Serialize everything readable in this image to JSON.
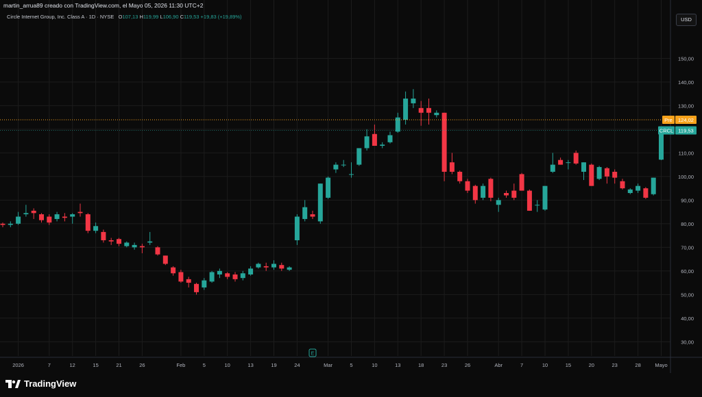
{
  "header": {
    "text": "martin_arrua89 creado con TradingView.com, el Mayo 05, 2026 11:30 UTC+2"
  },
  "legend": {
    "symbol": "Circle Internet Group, Inc. Class A · 1D · NYSE",
    "o_label": "O",
    "o_value": "107,13",
    "h_label": "H",
    "h_value": "119,99",
    "l_label": "L",
    "l_value": "106,90",
    "c_label": "C",
    "c_value": "119,53",
    "change": "+19,83 (+19,89%)"
  },
  "currency": "USD",
  "brand": {
    "name": "TradingView"
  },
  "colors": {
    "up": "#26a69a",
    "down": "#f23645",
    "pre": "#f7a21b",
    "background": "#0b0b0b",
    "grid": "#1c1c1c"
  },
  "chart_data": {
    "type": "candlestick",
    "title": "Circle Internet Group, Inc. Class A · 1D · NYSE",
    "ylim": [
      24,
      162
    ],
    "y_ticks": [
      30,
      40,
      50,
      60,
      70,
      80,
      90,
      100,
      110,
      120,
      130,
      140,
      150
    ],
    "y_tick_labels": [
      "30,00",
      "40,00",
      "50,00",
      "60,00",
      "70,00",
      "80,00",
      "90,00",
      "100,00",
      "110,00",
      "120,00",
      "130,00",
      "140,00",
      "150,00"
    ],
    "x_ticks": [
      {
        "i": 2,
        "label": "2026"
      },
      {
        "i": 6,
        "label": "7"
      },
      {
        "i": 9,
        "label": "12"
      },
      {
        "i": 12,
        "label": "15"
      },
      {
        "i": 15,
        "label": "21"
      },
      {
        "i": 18,
        "label": "26"
      },
      {
        "i": 23,
        "label": "Feb"
      },
      {
        "i": 26,
        "label": "5"
      },
      {
        "i": 29,
        "label": "10"
      },
      {
        "i": 32,
        "label": "13"
      },
      {
        "i": 35,
        "label": "19"
      },
      {
        "i": 38,
        "label": "24"
      },
      {
        "i": 42,
        "label": "Mar"
      },
      {
        "i": 45,
        "label": "5"
      },
      {
        "i": 48,
        "label": "10"
      },
      {
        "i": 51,
        "label": "13"
      },
      {
        "i": 54,
        "label": "18"
      },
      {
        "i": 57,
        "label": "23"
      },
      {
        "i": 60,
        "label": "26"
      },
      {
        "i": 64,
        "label": "Abr"
      },
      {
        "i": 67,
        "label": "7"
      },
      {
        "i": 70,
        "label": "10"
      },
      {
        "i": 73,
        "label": "15"
      },
      {
        "i": 76,
        "label": "20"
      },
      {
        "i": 79,
        "label": "23"
      },
      {
        "i": 82,
        "label": "28"
      },
      {
        "i": 85,
        "label": "Mayo"
      }
    ],
    "candles": [
      {
        "o": 80,
        "h": 80.5,
        "l": 78.5,
        "c": 79.5
      },
      {
        "o": 79.5,
        "h": 81,
        "l": 78.5,
        "c": 80
      },
      {
        "o": 80,
        "h": 85,
        "l": 79.5,
        "c": 83
      },
      {
        "o": 84,
        "h": 88,
        "l": 83,
        "c": 84.5
      },
      {
        "o": 85.5,
        "h": 86.5,
        "l": 82,
        "c": 84.5
      },
      {
        "o": 84,
        "h": 84.5,
        "l": 80.5,
        "c": 81.5
      },
      {
        "o": 83,
        "h": 84,
        "l": 79.5,
        "c": 80.5
      },
      {
        "o": 82,
        "h": 85,
        "l": 81,
        "c": 84
      },
      {
        "o": 83,
        "h": 84.5,
        "l": 81,
        "c": 82.5
      },
      {
        "o": 83,
        "h": 84.5,
        "l": 80,
        "c": 84
      },
      {
        "o": 85,
        "h": 88.5,
        "l": 83,
        "c": 84.5
      },
      {
        "o": 84,
        "h": 84.5,
        "l": 76,
        "c": 77
      },
      {
        "o": 77,
        "h": 80.5,
        "l": 76,
        "c": 79
      },
      {
        "o": 76.5,
        "h": 77.5,
        "l": 72,
        "c": 73
      },
      {
        "o": 73,
        "h": 74,
        "l": 71,
        "c": 72.5
      },
      {
        "o": 73.5,
        "h": 74,
        "l": 70.5,
        "c": 71.5
      },
      {
        "o": 70.5,
        "h": 72.5,
        "l": 70,
        "c": 72
      },
      {
        "o": 70,
        "h": 72,
        "l": 69,
        "c": 71
      },
      {
        "o": 70.5,
        "h": 71.5,
        "l": 67.5,
        "c": 70
      },
      {
        "o": 72,
        "h": 76.5,
        "l": 71,
        "c": 72.5
      },
      {
        "o": 70,
        "h": 70.5,
        "l": 66.5,
        "c": 67
      },
      {
        "o": 66.5,
        "h": 66.5,
        "l": 62.5,
        "c": 63
      },
      {
        "o": 61.5,
        "h": 62,
        "l": 58,
        "c": 59
      },
      {
        "o": 59.5,
        "h": 60.5,
        "l": 55,
        "c": 55.5
      },
      {
        "o": 56.5,
        "h": 57.5,
        "l": 53,
        "c": 55
      },
      {
        "o": 54.5,
        "h": 55,
        "l": 50,
        "c": 51
      },
      {
        "o": 53,
        "h": 57,
        "l": 52,
        "c": 56
      },
      {
        "o": 55.5,
        "h": 60,
        "l": 55,
        "c": 59.5
      },
      {
        "o": 58.5,
        "h": 61,
        "l": 57,
        "c": 60
      },
      {
        "o": 59,
        "h": 59.5,
        "l": 56.5,
        "c": 57.5
      },
      {
        "o": 58.5,
        "h": 59.5,
        "l": 55.5,
        "c": 56.5
      },
      {
        "o": 57,
        "h": 60,
        "l": 56,
        "c": 59
      },
      {
        "o": 58.5,
        "h": 62,
        "l": 58,
        "c": 61
      },
      {
        "o": 61.5,
        "h": 63.5,
        "l": 61,
        "c": 63
      },
      {
        "o": 62,
        "h": 63.5,
        "l": 60,
        "c": 61.5
      },
      {
        "o": 61.5,
        "h": 64.5,
        "l": 60.5,
        "c": 63
      },
      {
        "o": 62.5,
        "h": 63.5,
        "l": 60,
        "c": 61
      },
      {
        "o": 60.5,
        "h": 62,
        "l": 60,
        "c": 61.5
      },
      {
        "o": 73,
        "h": 84,
        "l": 71,
        "c": 83
      },
      {
        "o": 82,
        "h": 90,
        "l": 81,
        "c": 87
      },
      {
        "o": 84,
        "h": 85.5,
        "l": 82,
        "c": 83
      },
      {
        "o": 81,
        "h": 97,
        "l": 80,
        "c": 97
      },
      {
        "o": 91,
        "h": 100,
        "l": 90.5,
        "c": 99.5
      },
      {
        "o": 103,
        "h": 106,
        "l": 101.5,
        "c": 105
      },
      {
        "o": 105,
        "h": 107,
        "l": 104,
        "c": 105
      },
      {
        "o": 101,
        "h": 106,
        "l": 99.5,
        "c": 101
      },
      {
        "o": 105,
        "h": 112,
        "l": 104.5,
        "c": 112
      },
      {
        "o": 112,
        "h": 120,
        "l": 111,
        "c": 117
      },
      {
        "o": 118,
        "h": 122,
        "l": 113,
        "c": 113
      },
      {
        "o": 113,
        "h": 114.5,
        "l": 112,
        "c": 113.5
      },
      {
        "o": 114.5,
        "h": 119,
        "l": 114,
        "c": 117.5
      },
      {
        "o": 119,
        "h": 127,
        "l": 118.5,
        "c": 125
      },
      {
        "o": 124,
        "h": 136,
        "l": 122,
        "c": 133
      },
      {
        "o": 131,
        "h": 137,
        "l": 129,
        "c": 133
      },
      {
        "o": 129,
        "h": 132,
        "l": 121.5,
        "c": 127
      },
      {
        "o": 129,
        "h": 133,
        "l": 122,
        "c": 127
      },
      {
        "o": 126,
        "h": 128,
        "l": 125,
        "c": 127
      },
      {
        "o": 127,
        "h": 127,
        "l": 98,
        "c": 102
      },
      {
        "o": 106,
        "h": 110,
        "l": 101,
        "c": 102
      },
      {
        "o": 102,
        "h": 102.5,
        "l": 97,
        "c": 98
      },
      {
        "o": 98,
        "h": 99,
        "l": 93,
        "c": 94
      },
      {
        "o": 96,
        "h": 96.5,
        "l": 88.5,
        "c": 90
      },
      {
        "o": 91,
        "h": 97,
        "l": 90,
        "c": 96
      },
      {
        "o": 99,
        "h": 99.5,
        "l": 89.5,
        "c": 91
      },
      {
        "o": 88,
        "h": 91,
        "l": 85,
        "c": 90
      },
      {
        "o": 93,
        "h": 94,
        "l": 91,
        "c": 92
      },
      {
        "o": 94,
        "h": 97,
        "l": 90,
        "c": 91
      },
      {
        "o": 101,
        "h": 101.5,
        "l": 94,
        "c": 94
      },
      {
        "o": 94,
        "h": 94.5,
        "l": 85.5,
        "c": 85.5
      },
      {
        "o": 88,
        "h": 90,
        "l": 85,
        "c": 88
      },
      {
        "o": 86,
        "h": 96,
        "l": 85.5,
        "c": 96
      },
      {
        "o": 102,
        "h": 110,
        "l": 101.5,
        "c": 105
      },
      {
        "o": 107,
        "h": 108,
        "l": 105,
        "c": 105
      },
      {
        "o": 106,
        "h": 107,
        "l": 103,
        "c": 106
      },
      {
        "o": 110,
        "h": 111,
        "l": 105,
        "c": 105.5
      },
      {
        "o": 102,
        "h": 106,
        "l": 98.5,
        "c": 106
      },
      {
        "o": 105,
        "h": 105.5,
        "l": 96,
        "c": 96
      },
      {
        "o": 99,
        "h": 104.5,
        "l": 98.5,
        "c": 104
      },
      {
        "o": 103.5,
        "h": 104,
        "l": 97,
        "c": 100
      },
      {
        "o": 102,
        "h": 103,
        "l": 97,
        "c": 99.5
      },
      {
        "o": 98,
        "h": 99,
        "l": 94.5,
        "c": 95
      },
      {
        "o": 93,
        "h": 95,
        "l": 92.5,
        "c": 94.5
      },
      {
        "o": 94,
        "h": 97,
        "l": 93,
        "c": 96
      },
      {
        "o": 95,
        "h": 95.5,
        "l": 90.5,
        "c": 91
      },
      {
        "o": 92.5,
        "h": 99.5,
        "l": 92,
        "c": 99.5
      },
      {
        "o": 107.13,
        "h": 119.99,
        "l": 106.9,
        "c": 119.53
      }
    ],
    "last_price": {
      "label": "CRCL",
      "value": 119.53,
      "text": "119,53"
    },
    "pre_market": {
      "label": "Pre",
      "value": 124.02,
      "text": "124,02"
    },
    "event_marker": {
      "i": 40,
      "label": "E"
    },
    "grid": true
  }
}
